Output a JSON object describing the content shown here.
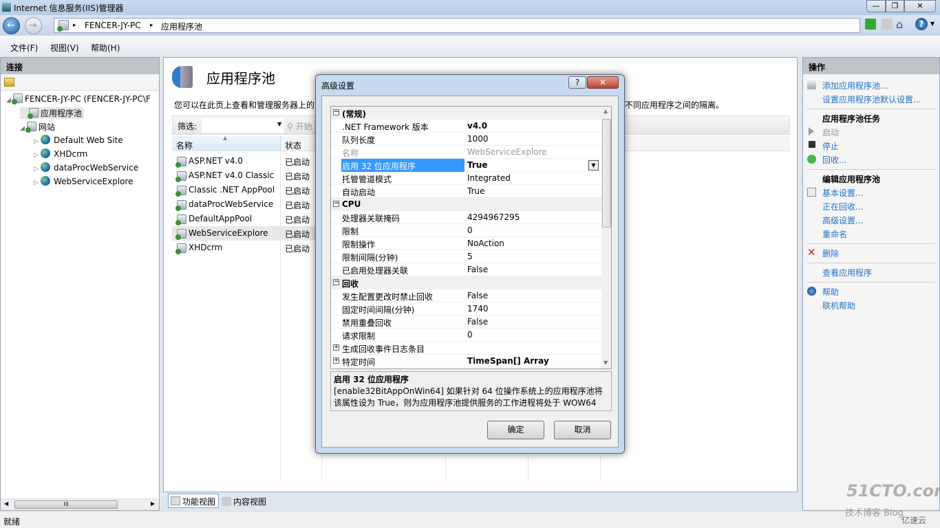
{
  "window": {
    "title": "Internet 信息服务(IIS)管理器",
    "minimize": "—",
    "restore": "❐",
    "close": "✕"
  },
  "address": {
    "segments": [
      "FENCER-JY-PC",
      "应用程序池"
    ],
    "separator": "▸"
  },
  "menu": [
    "文件(F)",
    "视图(V)",
    "帮助(H)"
  ],
  "connections": {
    "title": "连接",
    "tree": [
      {
        "label": "FENCER-JY-PC (FENCER-JY-PC\\F",
        "level": 0,
        "icon": "server-icon",
        "expander": "◢"
      },
      {
        "label": "应用程序池",
        "level": 1,
        "icon": "app-pool-icon",
        "selected": true
      },
      {
        "label": "网站",
        "level": 1,
        "icon": "sites-folder-icon",
        "expander": "◢"
      },
      {
        "label": "Default Web Site",
        "level": 2,
        "icon": "globe-icon",
        "expander": "▷"
      },
      {
        "label": "XHDcrm",
        "level": 2,
        "icon": "globe-icon",
        "expander": "▷"
      },
      {
        "label": "dataProcWebService",
        "level": 2,
        "icon": "globe-icon",
        "expander": "▷"
      },
      {
        "label": "WebServiceExplore",
        "level": 2,
        "icon": "globe-icon",
        "expander": "▷"
      }
    ],
    "scroll_grip": "III"
  },
  "main": {
    "title": "应用程序池",
    "description_left": "您可以在此页上查看和管理服务器上的",
    "description_right": "不同应用程序之间的隔离。",
    "filter_label": "筛选:",
    "filter_value": "",
    "start_label": "开始",
    "columns": [
      "名称",
      "状态"
    ],
    "rows": [
      {
        "name": "ASP.NET v4.0",
        "status": "已启动"
      },
      {
        "name": "ASP.NET v4.0 Classic",
        "status": "已启动"
      },
      {
        "name": "Classic .NET AppPool",
        "status": "已启动"
      },
      {
        "name": "dataProcWebService",
        "status": "已启动"
      },
      {
        "name": "DefaultAppPool",
        "status": "已启动"
      },
      {
        "name": "WebServiceExplore",
        "status": "已启动",
        "selected": true
      },
      {
        "name": "XHDcrm",
        "status": "已启动"
      }
    ],
    "view_tabs": [
      "功能视图",
      "内容视图"
    ]
  },
  "actions": {
    "title": "操作",
    "items": [
      {
        "type": "link",
        "label": "添加应用程序池...",
        "icon": "add-pool-icon"
      },
      {
        "type": "link",
        "label": "设置应用程序池默认设置..."
      },
      {
        "type": "sep"
      },
      {
        "type": "header",
        "label": "应用程序池任务"
      },
      {
        "type": "disabled",
        "label": "启动",
        "icon": "play-icon"
      },
      {
        "type": "link",
        "label": "停止",
        "icon": "stop-icon"
      },
      {
        "type": "link",
        "label": "回收...",
        "icon": "recycle-icon"
      },
      {
        "type": "sep"
      },
      {
        "type": "header",
        "label": "编辑应用程序池"
      },
      {
        "type": "link",
        "label": "基本设置...",
        "icon": "settings-icon"
      },
      {
        "type": "link",
        "label": "正在回收..."
      },
      {
        "type": "link",
        "label": "高级设置..."
      },
      {
        "type": "link",
        "label": "重命名"
      },
      {
        "type": "sep"
      },
      {
        "type": "link",
        "label": "删除",
        "icon": "delete-icon"
      },
      {
        "type": "sep"
      },
      {
        "type": "link",
        "label": "查看应用程序"
      },
      {
        "type": "sep"
      },
      {
        "type": "link",
        "label": "帮助",
        "icon": "help-icon"
      },
      {
        "type": "link",
        "label": "联机帮助"
      }
    ]
  },
  "dialog": {
    "title": "高级设置",
    "help": "?",
    "close": "✕",
    "properties": [
      {
        "cat": true,
        "label": "(常规)",
        "box": "−"
      },
      {
        "label": ".NET Framework 版本",
        "value": "v4.0",
        "bold": true
      },
      {
        "label": "队列长度",
        "value": "1000"
      },
      {
        "label": "名称",
        "value": "WebServiceExplore",
        "disabled": true
      },
      {
        "label": "启用 32 位应用程序",
        "value": "True",
        "bold": true,
        "selected": true,
        "dropdown": true
      },
      {
        "label": "托管管道模式",
        "value": "Integrated"
      },
      {
        "label": "自动启动",
        "value": "True"
      },
      {
        "cat": true,
        "label": "CPU",
        "box": "−"
      },
      {
        "label": "处理器关联掩码",
        "value": "4294967295"
      },
      {
        "label": "限制",
        "value": "0"
      },
      {
        "label": "限制操作",
        "value": "NoAction"
      },
      {
        "label": "限制间隔(分钟)",
        "value": "5"
      },
      {
        "label": "已启用处理器关联",
        "value": "False"
      },
      {
        "cat": true,
        "label": "回收",
        "box": "−"
      },
      {
        "label": "发生配置更改时禁止回收",
        "value": "False"
      },
      {
        "label": "固定时间间隔(分钟)",
        "value": "1740"
      },
      {
        "label": "禁用重叠回收",
        "value": "False"
      },
      {
        "label": "请求限制",
        "value": "0"
      },
      {
        "label": "生成回收事件日志条目",
        "value": "",
        "expander": "+"
      },
      {
        "label": "特定时间",
        "value": "TimeSpan[] Array",
        "bold": true,
        "expander": "+"
      }
    ],
    "desc_title": "启用 32 位应用程序",
    "desc_text": "[enable32BitAppOnWin64] 如果针对 64 位操作系统上的应用程序池将该属性设为 True，则为应用程序池提供服务的工作进程将处于 WOW64 (...",
    "ok": "确定",
    "cancel": "取消"
  },
  "status": "就绪",
  "watermark": {
    "line1": "51CTO.com",
    "line2": "技术博客 Blog",
    "brand": "亿速云"
  }
}
